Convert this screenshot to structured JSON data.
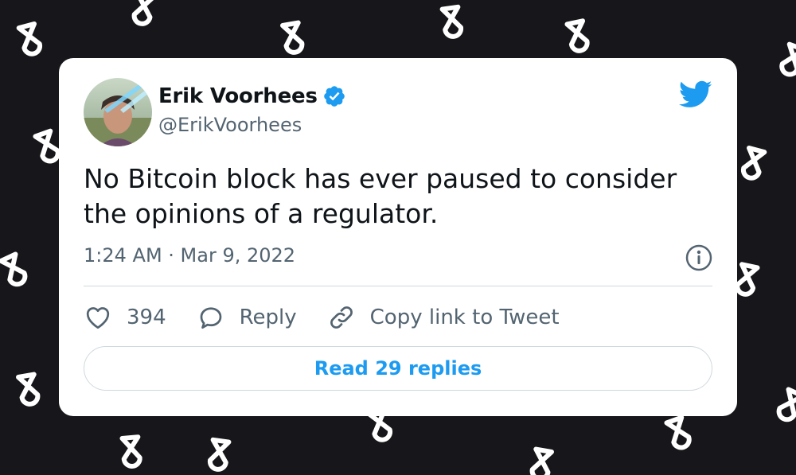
{
  "author": {
    "display_name": "Erik Voorhees",
    "handle": "@ErikVoorhees",
    "verified": true
  },
  "tweet": {
    "text": "No Bitcoin block has ever paused to consider the opinions of a regulator.",
    "timestamp": "1:24 AM · Mar 9, 2022"
  },
  "actions": {
    "like_count": "394",
    "reply_label": "Reply",
    "copy_link_label": "Copy link to Tweet"
  },
  "read_replies_label": "Read 29 replies",
  "icons": {
    "brand": "twitter-bird-icon",
    "verified": "verified-badge-icon",
    "info": "info-icon",
    "like": "heart-icon",
    "reply": "speech-bubble-icon",
    "copy_link": "link-icon"
  },
  "colors": {
    "background": "#17161a",
    "card": "#ffffff",
    "accent": "#1d9bf0",
    "primary_text": "#0f1419",
    "secondary_text": "#536471",
    "divider": "#cfd9de"
  }
}
